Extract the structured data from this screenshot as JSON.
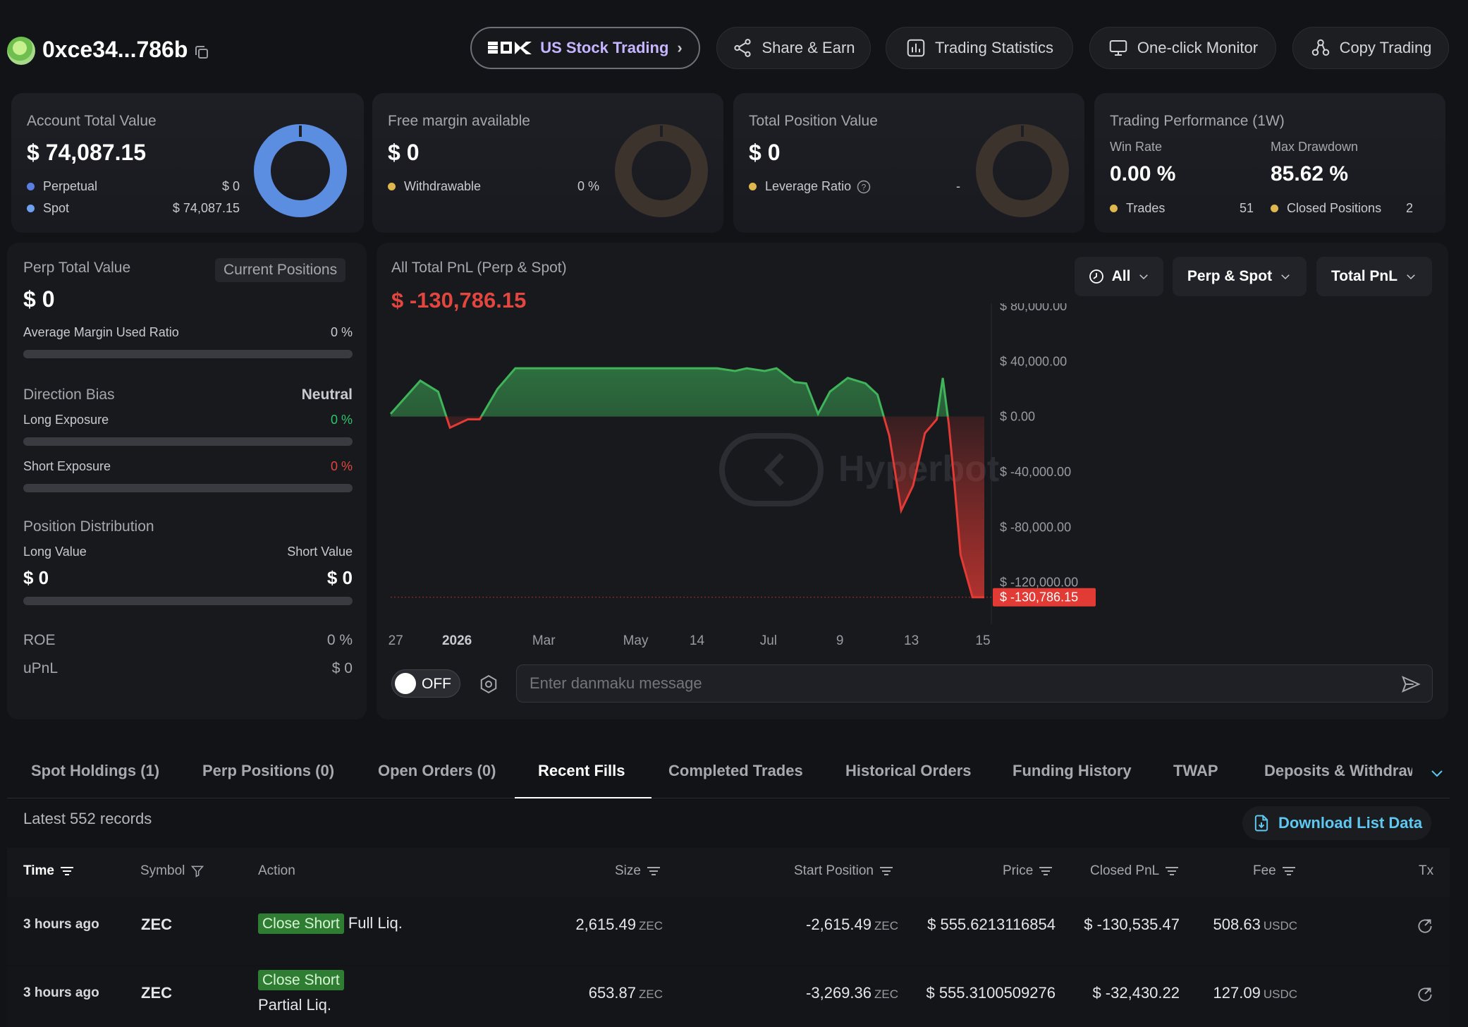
{
  "header": {
    "address": "0xce34...786b",
    "buttons": {
      "us_stock": "US Stock Trading",
      "share": "Share & Earn",
      "stats": "Trading Statistics",
      "monitor": "One-click Monitor",
      "copy": "Copy Trading"
    }
  },
  "cards": {
    "account": {
      "title": "Account Total Value",
      "value": "$ 74,087.15",
      "perpetual_label": "Perpetual",
      "perpetual_value": "$ 0",
      "spot_label": "Spot",
      "spot_value": "$ 74,087.15",
      "spot_share": 1.0
    },
    "margin": {
      "title": "Free margin available",
      "value": "$ 0",
      "withdrawable_label": "Withdrawable",
      "withdrawable_value": "0 %"
    },
    "position": {
      "title": "Total Position Value",
      "value": "$ 0",
      "leverage_label": "Leverage Ratio",
      "leverage_value": "-"
    },
    "performance": {
      "title": "Trading Performance (1W)",
      "win_rate_label": "Win Rate",
      "win_rate_value": "0.00 %",
      "drawdown_label": "Max Drawdown",
      "drawdown_value": "85.62 %",
      "trades_label": "Trades",
      "trades_value": "51",
      "closed_label": "Closed Positions",
      "closed_value": "2"
    }
  },
  "perp_panel": {
    "title": "Perp Total Value",
    "current_positions": "Current Positions",
    "value": "$ 0",
    "margin_used_label": "Average Margin Used Ratio",
    "margin_used_value": "0 %",
    "direction_label": "Direction Bias",
    "direction_value": "Neutral",
    "long_exposure_label": "Long Exposure",
    "long_exposure_value": "0 %",
    "short_exposure_label": "Short Exposure",
    "short_exposure_value": "0 %",
    "distribution_label": "Position Distribution",
    "long_value_label": "Long Value",
    "short_value_label": "Short Value",
    "long_value": "$ 0",
    "short_value": "$ 0",
    "roe_label": "ROE",
    "roe_value": "0 %",
    "upnl_label": "uPnL",
    "upnl_value": "$ 0"
  },
  "pnl_panel": {
    "title": "All Total PnL (Perp & Spot)",
    "value": "$ -130,786.15",
    "filters": {
      "range": "All",
      "scope": "Perp & Spot",
      "metric": "Total PnL"
    },
    "watermark": "Hyperbot",
    "toggle_label": "OFF",
    "danmaku_placeholder": "Enter danmaku message"
  },
  "chart_data": {
    "type": "area",
    "title": "All Total PnL (Perp & Spot)",
    "x_ticks": [
      "27",
      "2026",
      "Mar",
      "May",
      "14",
      "Jul",
      "9",
      "13",
      "15"
    ],
    "y_ticks": [
      "$ 80,000.00",
      "$ 40,000.00",
      "$ 0.00",
      "$ -40,000.00",
      "$ -80,000.00",
      "$ -120,000.00"
    ],
    "ylim": [
      -135000,
      82000
    ],
    "y_tick_values": [
      80000,
      40000,
      0,
      -40000,
      -80000,
      -120000
    ],
    "current_label": "$ -130,786.15",
    "current_value": -130786.15,
    "x": [
      0,
      0.05,
      0.08,
      0.1,
      0.13,
      0.15,
      0.18,
      0.21,
      0.25,
      0.4,
      0.55,
      0.58,
      0.6,
      0.63,
      0.65,
      0.68,
      0.7,
      0.72,
      0.74,
      0.77,
      0.8,
      0.82,
      0.84,
      0.86,
      0.88,
      0.9,
      0.92,
      0.93,
      0.94,
      0.95,
      0.96,
      0.98,
      1.0
    ],
    "values": [
      2000,
      26000,
      18000,
      -8000,
      -2000,
      -2000,
      20000,
      35000,
      35000,
      35000,
      35000,
      33000,
      35000,
      33000,
      35000,
      25000,
      24000,
      2000,
      18000,
      28000,
      24000,
      16000,
      -14000,
      -68000,
      -50000,
      -12000,
      -2000,
      28000,
      -5000,
      -50000,
      -100000,
      -130786,
      -130786
    ],
    "colors": {
      "positive": "#3fb45a",
      "negative": "#e23a34"
    }
  },
  "tabs": [
    "Spot Holdings (1)",
    "Perp Positions (0)",
    "Open Orders (0)",
    "Recent Fills",
    "Completed Trades",
    "Historical Orders",
    "Funding History",
    "TWAP",
    "Deposits & Withdraw"
  ],
  "table": {
    "records": "Latest 552 records",
    "download": "Download List Data",
    "headers": {
      "time": "Time",
      "symbol": "Symbol",
      "action": "Action",
      "size": "Size",
      "start": "Start Position",
      "price": "Price",
      "pnl": "Closed PnL",
      "fee": "Fee",
      "tx": "Tx"
    },
    "rows": [
      {
        "time": "3 hours ago",
        "symbol": "ZEC",
        "tag": "Close Short",
        "action": "Full Liq.",
        "size": "2,615.49",
        "size_unit": "ZEC",
        "start": "-2,615.49",
        "start_unit": "ZEC",
        "price": "$ 555.6213116854",
        "pnl": "$ -130,535.47",
        "fee": "508.63",
        "fee_unit": "USDC"
      },
      {
        "time": "3 hours ago",
        "symbol": "ZEC",
        "tag": "Close Short",
        "action": "Partial Liq.",
        "size": "653.87",
        "size_unit": "ZEC",
        "start": "-3,269.36",
        "start_unit": "ZEC",
        "price": "$ 555.3100509276",
        "pnl": "$ -32,430.22",
        "fee": "127.09",
        "fee_unit": "USDC"
      }
    ]
  }
}
